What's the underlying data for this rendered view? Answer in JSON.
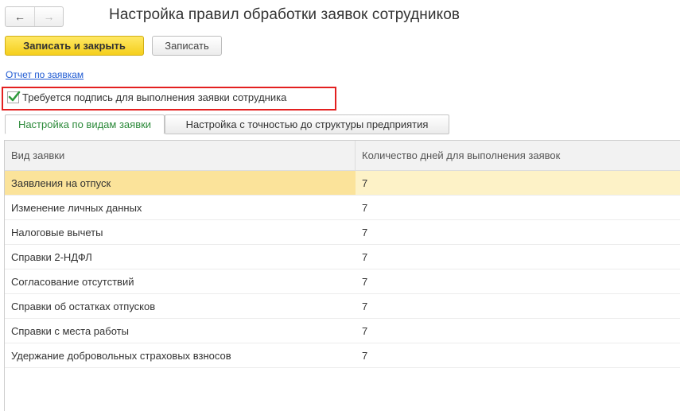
{
  "window": {
    "title": "Настройка правил обработки заявок сотрудников",
    "nav": {
      "back_icon": "←",
      "forward_icon": "→"
    }
  },
  "toolbar": {
    "save_close_label": "Записать и закрыть",
    "save_label": "Записать"
  },
  "report_link": "Отчет по заявкам",
  "signature_required": {
    "label": "Требуется подпись для выполнения заявки сотрудника",
    "checked": true
  },
  "tabs": [
    {
      "label": "Настройка по видам заявки",
      "active": true
    },
    {
      "label": "Настройка с точностью до структуры предприятия",
      "active": false
    }
  ],
  "table": {
    "columns": [
      "Вид заявки",
      "Количество дней для выполнения заявок"
    ],
    "rows": [
      {
        "type": "Заявления на отпуск",
        "days": "7",
        "selected": true
      },
      {
        "type": "Изменение личных данных",
        "days": "7"
      },
      {
        "type": "Налоговые вычеты",
        "days": "7"
      },
      {
        "type": "Справки 2-НДФЛ",
        "days": "7"
      },
      {
        "type": "Согласование отсутствий",
        "days": "7"
      },
      {
        "type": "Справки об остатках отпусков",
        "days": "7"
      },
      {
        "type": "Справки с места работы",
        "days": "7"
      },
      {
        "type": "Удержание добровольных страховых взносов",
        "days": "7"
      }
    ]
  },
  "colors": {
    "primary_button": "#f5cf1c",
    "active_tab_text": "#2c8a3a",
    "highlight_border": "#e32020",
    "selected_row": "#fbe39a",
    "link": "#1f5ad2"
  }
}
